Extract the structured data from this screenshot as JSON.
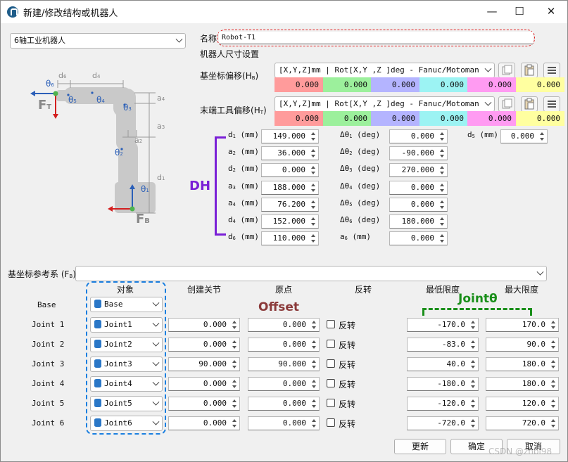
{
  "window": {
    "title": "新建/修改结构或机器人",
    "minimize": "—",
    "maximize": "☐",
    "close": "✕"
  },
  "robot_type": "6轴工业机器人",
  "name_label": "名称",
  "name_value": "Robot-T1",
  "size_label": "机器人尺寸设置",
  "base_offset": {
    "label_main": "基坐标偏移",
    "label_sub": "(H",
    "label_sub2": "B",
    "label_end": ")",
    "format": "[X,Y,Z]mm | Rot[X,Y ,Z  ]deg - Fanuc/Motoman",
    "values": [
      "0.000",
      "0.000",
      "0.000",
      "0.000",
      "0.000",
      "0.000"
    ]
  },
  "tool_offset": {
    "label_main": "末端工具偏移",
    "label_sub": "(H",
    "label_sub2": "T",
    "label_end": ")",
    "format": "[X,Y,Z]mm | Rot[X,Y ,Z  ]deg - Fanuc/Motoman",
    "values": [
      "0.000",
      "0.000",
      "0.000",
      "0.000",
      "0.000",
      "0.000"
    ]
  },
  "colors": [
    "#ff9b9b",
    "#9cf09c",
    "#b4b4ff",
    "#9cf3f3",
    "#ff9bf2",
    "#ffffa0"
  ],
  "dh_tag": "DH",
  "dh_left": [
    {
      "sym": "d",
      "sub": "1",
      "unit": "(mm)",
      "value": "149.000"
    },
    {
      "sym": "a",
      "sub": "2",
      "unit": "(mm)",
      "value": "36.000"
    },
    {
      "sym": "d",
      "sub": "2",
      "unit": "(mm)",
      "value": "0.000"
    },
    {
      "sym": "a",
      "sub": "3",
      "unit": "(mm)",
      "value": "188.000"
    },
    {
      "sym": "a",
      "sub": "4",
      "unit": "(mm)",
      "value": "76.200"
    },
    {
      "sym": "d",
      "sub": "4",
      "unit": "(mm)",
      "value": "152.000"
    },
    {
      "sym": "d",
      "sub": "6",
      "unit": "(mm)",
      "value": "110.000"
    }
  ],
  "dh_mid": [
    {
      "sym": "Δθ",
      "sub": "1",
      "unit": "(deg)",
      "value": "0.000"
    },
    {
      "sym": "Δθ",
      "sub": "2",
      "unit": "(deg)",
      "value": "-90.000"
    },
    {
      "sym": "Δθ",
      "sub": "3",
      "unit": "(deg)",
      "value": "270.000"
    },
    {
      "sym": "Δθ",
      "sub": "4",
      "unit": "(deg)",
      "value": "0.000"
    },
    {
      "sym": "Δθ",
      "sub": "5",
      "unit": "(deg)",
      "value": "0.000"
    },
    {
      "sym": "Δθ",
      "sub": "6",
      "unit": "(deg)",
      "value": "180.000"
    },
    {
      "sym": "a",
      "sub": "6",
      "unit": "(mm)",
      "value": "0.000"
    }
  ],
  "dh_extra": {
    "sym": "d",
    "sub": "5",
    "unit": "(mm)",
    "value": "0.000"
  },
  "base_ref": {
    "label": "基坐标参考系 (F",
    "sub": "B",
    "end": ")",
    "value": ""
  },
  "headers": {
    "object": "对象",
    "create_joint": "创建关节",
    "origin": "原点",
    "reverse": "反转",
    "min_limit": "最低限度",
    "max_limit": "最大限度"
  },
  "annotations": {
    "offset": "Offset",
    "joint_theta": "Jointθ"
  },
  "base_row": {
    "label": "Base",
    "object": "Base"
  },
  "joints": [
    {
      "label": "Joint 1",
      "object": "Joint1",
      "create": "0.000",
      "origin": "0.000",
      "reverse": "反转",
      "min": "-170.0",
      "max": "170.0"
    },
    {
      "label": "Joint 2",
      "object": "Joint2",
      "create": "0.000",
      "origin": "0.000",
      "reverse": "反转",
      "min": "-83.0",
      "max": "90.0"
    },
    {
      "label": "Joint 3",
      "object": "Joint3",
      "create": "90.000",
      "origin": "90.000",
      "reverse": "反转",
      "min": "40.0",
      "max": "180.0"
    },
    {
      "label": "Joint 4",
      "object": "Joint4",
      "create": "0.000",
      "origin": "0.000",
      "reverse": "反转",
      "min": "-180.0",
      "max": "180.0"
    },
    {
      "label": "Joint 5",
      "object": "Joint5",
      "create": "0.000",
      "origin": "0.000",
      "reverse": "反转",
      "min": "-120.0",
      "max": "120.0"
    },
    {
      "label": "Joint 6",
      "object": "Joint6",
      "create": "0.000",
      "origin": "0.000",
      "reverse": "反转",
      "min": "-720.0",
      "max": "720.0"
    }
  ],
  "buttons": {
    "update": "更新",
    "ok": "确定",
    "cancel": "取消"
  },
  "diagram": {
    "d6": "d",
    "d6s": "6",
    "d4": "d",
    "d4s": "4",
    "a4": "a",
    "a4s": "4",
    "a3": "a",
    "a3s": "3",
    "a2": "a",
    "a2s": "2",
    "d1": "d",
    "d1s": "1",
    "t6": "θ",
    "t6s": "6",
    "t5": "θ",
    "t5s": "5",
    "t4": "θ",
    "t4s": "4",
    "t3": "θ",
    "t3s": "3",
    "t2": "θ",
    "t2s": "2",
    "t1": "θ",
    "t1s": "1",
    "ft": "F",
    "fts": "T",
    "fb": "F",
    "fbs": "B"
  },
  "watermark": "CSDN @zhbi98"
}
